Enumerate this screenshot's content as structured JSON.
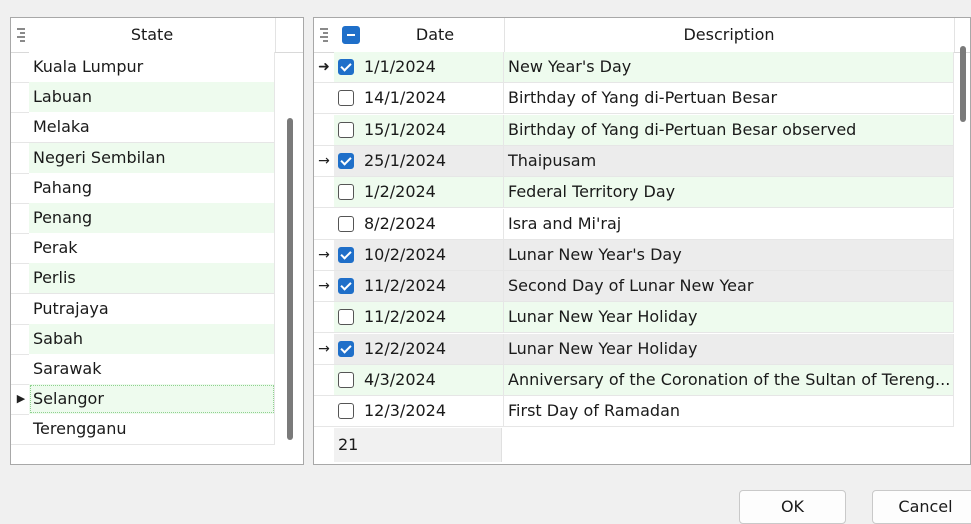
{
  "state_grid": {
    "header": "State",
    "rows": [
      {
        "name": "Kuala Lumpur",
        "alt": false,
        "current": false
      },
      {
        "name": "Labuan",
        "alt": true,
        "current": false
      },
      {
        "name": "Melaka",
        "alt": false,
        "current": false
      },
      {
        "name": "Negeri Sembilan",
        "alt": true,
        "current": false
      },
      {
        "name": "Pahang",
        "alt": false,
        "current": false
      },
      {
        "name": "Penang",
        "alt": true,
        "current": false
      },
      {
        "name": "Perak",
        "alt": false,
        "current": false
      },
      {
        "name": "Perlis",
        "alt": true,
        "current": false
      },
      {
        "name": "Putrajaya",
        "alt": false,
        "current": false
      },
      {
        "name": "Sabah",
        "alt": true,
        "current": false
      },
      {
        "name": "Sarawak",
        "alt": false,
        "current": false
      },
      {
        "name": "Selangor",
        "alt": true,
        "current": true
      },
      {
        "name": "Terengganu",
        "alt": false,
        "current": false
      }
    ]
  },
  "holiday_grid": {
    "date_header": "Date",
    "description_header": "Description",
    "rows": [
      {
        "date": "1/1/2024",
        "description": "New Year's Day",
        "checked": true,
        "indicator": "focused",
        "bg": "alt"
      },
      {
        "date": "14/1/2024",
        "description": "Birthday of Yang di-Pertuan Besar",
        "checked": false,
        "indicator": "",
        "bg": "white"
      },
      {
        "date": "15/1/2024",
        "description": "Birthday of Yang di-Pertuan Besar observed",
        "checked": false,
        "indicator": "",
        "bg": "alt"
      },
      {
        "date": "25/1/2024",
        "description": "Thaipusam",
        "checked": true,
        "indicator": "selected",
        "bg": "selected"
      },
      {
        "date": "1/2/2024",
        "description": "Federal Territory Day",
        "checked": false,
        "indicator": "",
        "bg": "alt"
      },
      {
        "date": "8/2/2024",
        "description": "Isra and Mi'raj",
        "checked": false,
        "indicator": "",
        "bg": "white"
      },
      {
        "date": "10/2/2024",
        "description": "Lunar New Year's Day",
        "checked": true,
        "indicator": "selected",
        "bg": "selected"
      },
      {
        "date": "11/2/2024",
        "description": "Second Day of Lunar New Year",
        "checked": true,
        "indicator": "selected",
        "bg": "selected"
      },
      {
        "date": "11/2/2024",
        "description": "Lunar New Year Holiday",
        "checked": false,
        "indicator": "",
        "bg": "alt"
      },
      {
        "date": "12/2/2024",
        "description": "Lunar New Year Holiday",
        "checked": true,
        "indicator": "selected",
        "bg": "selected"
      },
      {
        "date": "4/3/2024",
        "description": "Anniversary of the Coronation of the Sultan of Tereng...",
        "checked": false,
        "indicator": "",
        "bg": "alt"
      },
      {
        "date": "12/3/2024",
        "description": "First Day of Ramadan",
        "checked": false,
        "indicator": "",
        "bg": "white"
      }
    ],
    "footer_count": "21"
  },
  "buttons": {
    "ok": "OK",
    "cancel": "Cancel"
  },
  "colors": {
    "alt_row": "#eefbee",
    "selected_row": "#ececec",
    "checkbox_blue": "#1f6fc9",
    "focused_row_border": "#8fd18f"
  }
}
